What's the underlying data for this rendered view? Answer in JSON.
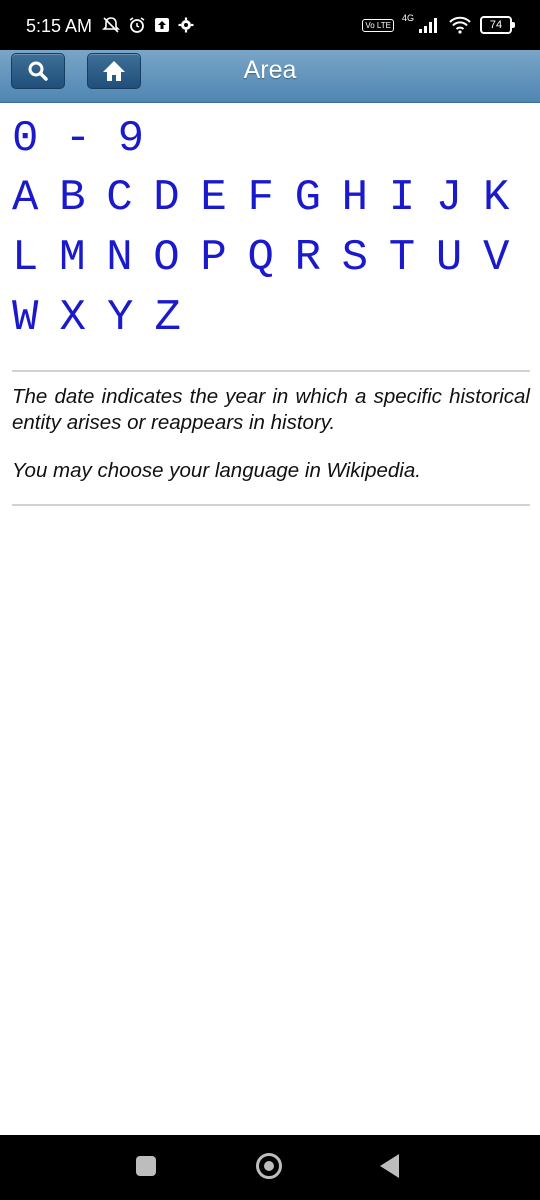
{
  "status_bar": {
    "time": "5:15 AM",
    "network": "4G",
    "volte": "Vo LTE",
    "battery": "74"
  },
  "header": {
    "title": "Area",
    "search_icon": "search-icon",
    "home_icon": "home-icon"
  },
  "index": {
    "range": "0 - 9",
    "row1": [
      "A",
      "B",
      "C",
      "D",
      "E",
      "F",
      "G",
      "H",
      "I",
      "J",
      "K"
    ],
    "row2": [
      "L",
      "M",
      "N",
      "O",
      "P",
      "Q",
      "R",
      "S",
      "T",
      "U",
      "V"
    ],
    "row3": [
      "W",
      "X",
      "Y",
      "Z"
    ]
  },
  "notes": {
    "date_note": "The date indicates the year in which a specific historical entity arises or reappears in history.",
    "language_note": "You may choose your language in Wikipedia."
  },
  "colors": {
    "link": "#1a1acc",
    "header_gradient_top": "#79a5c7",
    "header_gradient_bottom": "#4f86b3"
  }
}
